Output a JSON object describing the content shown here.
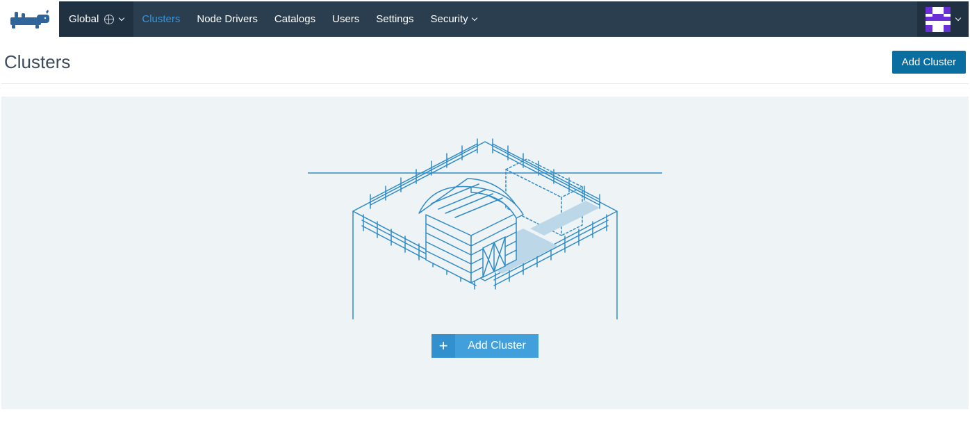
{
  "nav": {
    "scope_label": "Global",
    "items": [
      {
        "label": "Clusters",
        "active": true,
        "has_dropdown": false
      },
      {
        "label": "Node Drivers",
        "active": false,
        "has_dropdown": false
      },
      {
        "label": "Catalogs",
        "active": false,
        "has_dropdown": false
      },
      {
        "label": "Users",
        "active": false,
        "has_dropdown": false
      },
      {
        "label": "Settings",
        "active": false,
        "has_dropdown": false
      },
      {
        "label": "Security",
        "active": false,
        "has_dropdown": true
      }
    ]
  },
  "page": {
    "title": "Clusters",
    "add_button": "Add Cluster"
  },
  "empty_state": {
    "add_button": "Add Cluster",
    "plus": "+"
  },
  "colors": {
    "topbar": "#2a3e4f",
    "topbar_dark": "#203242",
    "accent": "#3497da",
    "button_primary": "#0a6ea0",
    "button_add": "#419fdc",
    "illustration_stroke": "#2e8bc7",
    "empty_bg": "#eef3f5"
  }
}
